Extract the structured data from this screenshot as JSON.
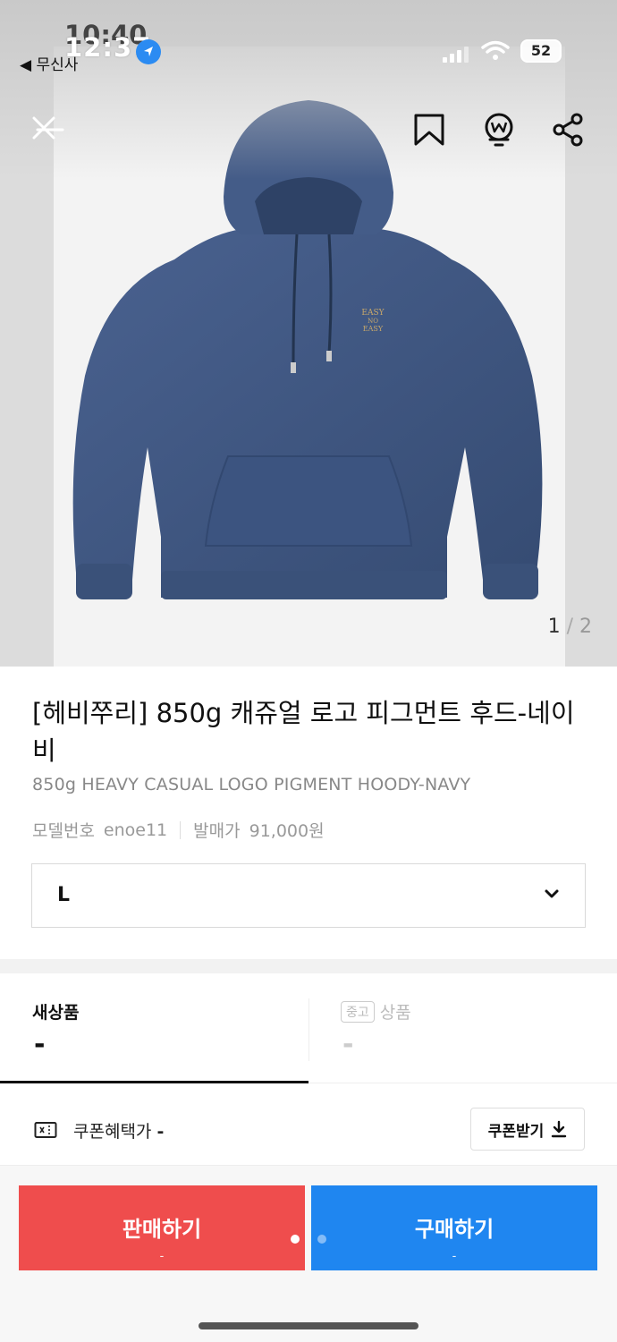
{
  "status_bar": {
    "time": "12:37",
    "time_ghost": "10:40",
    "back_app": "◀ 무신사",
    "battery": "52"
  },
  "hero": {
    "logo_lines": [
      "EASY",
      "NO",
      "EASY"
    ],
    "page_current": "1",
    "page_sep": "/",
    "page_total": "2"
  },
  "toolbar": {
    "icons": [
      "close-icon",
      "bookmark-icon",
      "bell-w-icon",
      "share-icon"
    ]
  },
  "product": {
    "title": "[헤비쭈리] 850g 캐쥬얼 로고 피그먼트 후드-네이비",
    "subtitle": "850g HEAVY CASUAL LOGO PIGMENT HOODY-NAVY",
    "model_label": "모델번호",
    "model_value": "enoe11",
    "release_label": "발매가",
    "release_value": "91,000원"
  },
  "size_select": {
    "value": "L"
  },
  "tabs": {
    "new": {
      "label": "새상품",
      "price": "-"
    },
    "used": {
      "badge": "중고",
      "label": "상품",
      "price": "-"
    }
  },
  "coupon": {
    "label": "쿠폰혜택가",
    "value": "-",
    "button": "쿠폰받기"
  },
  "actions": {
    "sell": {
      "label": "판매하기",
      "price": "-"
    },
    "buy": {
      "label": "구매하기",
      "price": "-"
    }
  },
  "colors": {
    "sell": "#ef4d4d",
    "buy": "#1f86f0",
    "hoodie": "#3f5780"
  }
}
